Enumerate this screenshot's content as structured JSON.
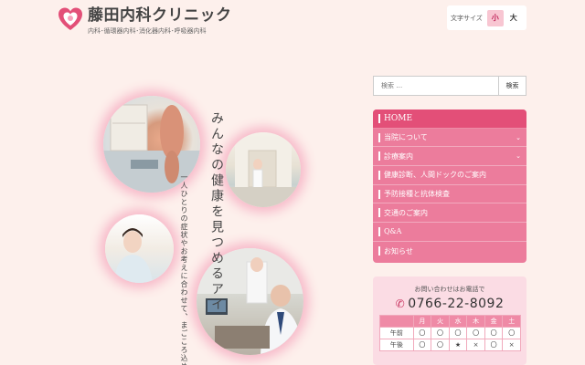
{
  "header": {
    "clinic_name": "藤田内科クリニック",
    "departments": "内科･循環器内科･消化器内科･呼吸器内科",
    "logo_icon": "heart-logo-icon",
    "brand_color": "#e34f78"
  },
  "font_size": {
    "label": "文字サイズ",
    "small": "小",
    "large": "大"
  },
  "hero": {
    "headline": "みんなの健康を見つめるアイ",
    "subtext": "一人ひとりの症状やお考えに合わせて、まごころ込めた医療でお応えします。"
  },
  "search": {
    "placeholder": "検索 …",
    "button": "検索"
  },
  "nav": {
    "items": [
      {
        "label": "HOME"
      },
      {
        "label": "当院について"
      },
      {
        "label": "診療案内"
      },
      {
        "label": "健康診断、人間ドックのご案内"
      },
      {
        "label": "予防接種と抗体検査"
      },
      {
        "label": "交通のご案内"
      },
      {
        "label": "Q&A"
      },
      {
        "label": "お知らせ"
      }
    ]
  },
  "contact": {
    "label": "お問い合わせはお電話で",
    "phone": "0766-22-8092",
    "phone_icon": "phone-icon"
  },
  "hours": {
    "headers": [
      "",
      "月",
      "火",
      "水",
      "木",
      "金",
      "土"
    ],
    "rows": [
      {
        "label": "午前",
        "cells": [
          "〇",
          "〇",
          "〇",
          "〇",
          "〇",
          "〇"
        ]
      },
      {
        "label": "午後",
        "cells": [
          "〇",
          "〇",
          "★",
          "×",
          "〇",
          "×"
        ]
      }
    ]
  }
}
